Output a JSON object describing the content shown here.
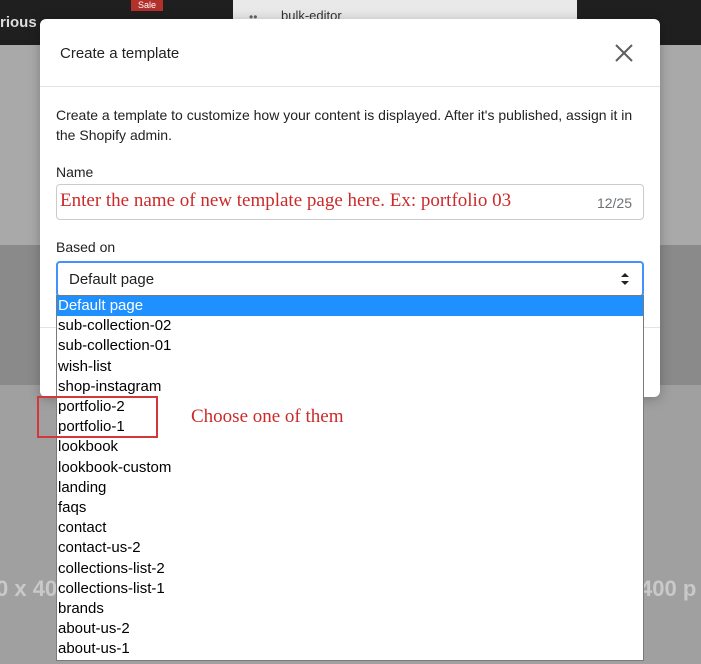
{
  "background": {
    "brand_fragment": "rious",
    "sale_badge": "Sale",
    "tab_title": "bulk-editor",
    "tab_dots": "••",
    "big_text_left": "0 x 40",
    "big_text_right": "400 p"
  },
  "modal": {
    "title": "Create a template",
    "description": "Create a template to customize how your content is displayed. After it's published, assign it in the Shopify admin.",
    "name_label": "Name",
    "name_value": "Enter the name of new template page here. Ex: portfolio 03",
    "name_char_count": "12/25",
    "based_on_label": "Based on",
    "based_on_value": "Default page"
  },
  "dropdown": {
    "options": [
      "Default page",
      "sub-collection-02",
      "sub-collection-01",
      "wish-list",
      "shop-instagram",
      "portfolio-2",
      "portfolio-1",
      "lookbook",
      "lookbook-custom",
      "landing",
      "faqs",
      "contact",
      "contact-us-2",
      "collections-list-2",
      "collections-list-1",
      "brands",
      "about-us-2",
      "about-us-1"
    ],
    "selected_index": 0
  },
  "annotation": {
    "callout_text": "Choose one of them"
  },
  "colors": {
    "selected_option": "#1e90ff",
    "annotation_red": "#cc2a2a",
    "focus_blue": "#458fff"
  }
}
